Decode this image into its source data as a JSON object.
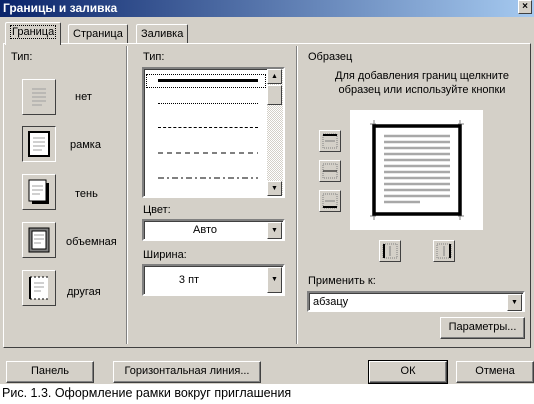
{
  "window": {
    "title": "Границы и заливка",
    "title_button": "×"
  },
  "tabs": [
    {
      "label": "Граница",
      "active": true
    },
    {
      "label": "Страница",
      "active": false
    },
    {
      "label": "Заливка",
      "active": false
    }
  ],
  "setting": {
    "label": "Тип:",
    "options": [
      {
        "label": "нет",
        "icon": "setting-none-icon"
      },
      {
        "label": "рамка",
        "icon": "setting-box-icon",
        "selected": true
      },
      {
        "label": "тень",
        "icon": "setting-shadow-icon"
      },
      {
        "label": "объемная",
        "icon": "setting-3d-icon"
      },
      {
        "label": "другая",
        "icon": "setting-custom-icon"
      }
    ]
  },
  "style": {
    "label": "Тип:",
    "selected_index": 0
  },
  "color": {
    "label": "Цвет:",
    "value": "Авто"
  },
  "width": {
    "label": "Ширина:",
    "value": "3 пт"
  },
  "preview": {
    "label": "Образец",
    "hint": "Для добавления границ щелкните образец или используйте кнопки"
  },
  "apply_to": {
    "label": "Применить к:",
    "value": "абзацу"
  },
  "buttons": {
    "options": "Параметры...",
    "toolbar": "Панель",
    "horizontal_line": "Горизонтальная линия...",
    "ok": "ОК",
    "cancel": "Отмена"
  },
  "caption": "Рис. 1.3. Оформление рамки вокруг приглашения",
  "colors": {
    "face": "#d4d0c8",
    "title_start": "#0a246a",
    "title_end": "#a6caf0"
  }
}
